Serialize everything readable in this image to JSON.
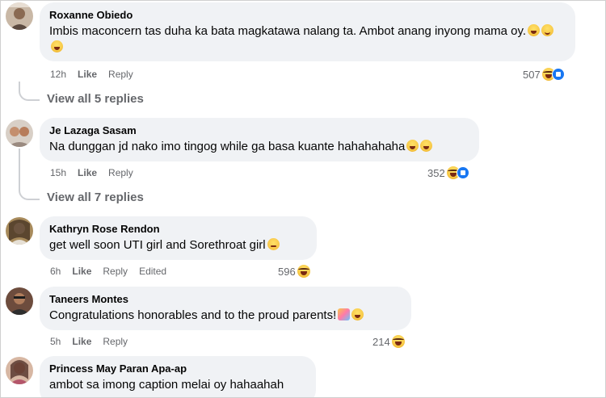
{
  "comments": [
    {
      "author": "Roxanne Obiedo",
      "text": "Imbis maconcern tas duha ka bata magkatawa nalang ta. Ambot anang inyong mama oy.",
      "time": "12h",
      "like": "Like",
      "reply": "Reply",
      "count": "507"
    },
    {
      "author": "Je Lazaga Sasam",
      "text": "Na dunggan jd nako imo tingog while ga basa kuante hahahahaha",
      "time": "15h",
      "like": "Like",
      "reply": "Reply",
      "count": "352"
    },
    {
      "author": "Kathryn Rose Rendon",
      "text": "get well soon UTI girl and Sorethroat girl",
      "time": "6h",
      "like": "Like",
      "reply": "Reply",
      "edited": "Edited",
      "count": "596"
    },
    {
      "author": "Taneers Montes",
      "text": "Congratulations honorables and to the proud parents!",
      "time": "5h",
      "like": "Like",
      "reply": "Reply",
      "count": "214"
    },
    {
      "author": "Princess May Paran Apa-ap",
      "text": "ambot sa imong caption melai oy hahaahah"
    }
  ],
  "view_replies": [
    "View all 5 replies",
    "View all 7 replies"
  ]
}
